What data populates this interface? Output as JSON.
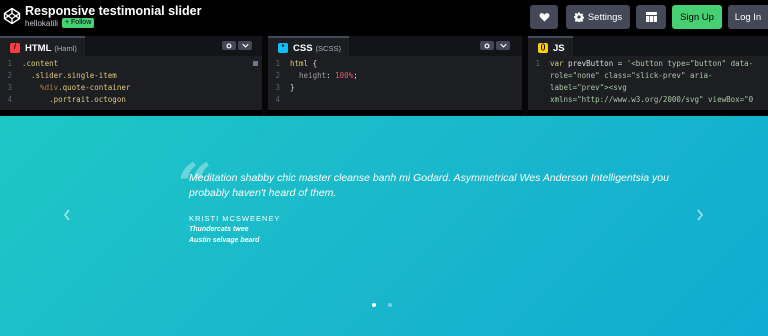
{
  "header": {
    "title": "Responsive testimonial slider",
    "author": "hellokatili",
    "follow_label": "+ Follow",
    "buttons": {
      "heart_icon": "heart-icon",
      "settings_label": "Settings",
      "layout_icon": "layout-icon",
      "signup_label": "Sign Up",
      "login_label": "Log In"
    }
  },
  "editors": [
    {
      "lang": "HTML",
      "sub": "(Haml)",
      "icon_letter": "/",
      "icon_color": "#ff3c41",
      "lines": [
        {
          "n": "1",
          "segments": [
            {
              "t": ".content",
              "c": "c-sel"
            }
          ]
        },
        {
          "n": "2",
          "segments": [
            {
              "t": "  .slider.single-item",
              "c": "c-sel"
            }
          ]
        },
        {
          "n": "3",
          "segments": [
            {
              "t": "    %div",
              "c": "c-tag"
            },
            {
              "t": ".quote-container",
              "c": "c-sel"
            }
          ]
        },
        {
          "n": "4",
          "segments": [
            {
              "t": "      .portrait.octogon",
              "c": "c-sel"
            }
          ]
        }
      ]
    },
    {
      "lang": "CSS",
      "sub": "(SCSS)",
      "icon_letter": "*",
      "icon_color": "#0ebeff",
      "lines": [
        {
          "n": "1",
          "segments": [
            {
              "t": "html",
              "c": "c-sel"
            },
            {
              "t": " {",
              "c": "c-plain"
            }
          ]
        },
        {
          "n": "2",
          "segments": [
            {
              "t": "  height",
              "c": "c-prop"
            },
            {
              "t": ": ",
              "c": "c-plain"
            },
            {
              "t": "100%",
              "c": "c-num"
            },
            {
              "t": ";",
              "c": "c-plain"
            }
          ]
        },
        {
          "n": "3",
          "segments": [
            {
              "t": "}",
              "c": "c-plain"
            }
          ]
        },
        {
          "n": "4",
          "segments": []
        }
      ]
    },
    {
      "lang": "JS",
      "sub": "",
      "icon_letter": "()",
      "icon_color": "#fcd000",
      "lines": [
        {
          "n": "1",
          "segments": [
            {
              "t": "var",
              "c": "c-kw"
            },
            {
              "t": " prevButton = ",
              "c": "c-plain"
            },
            {
              "t": "'<button type=\"button\" data-",
              "c": "c-str"
            }
          ]
        },
        {
          "n": "",
          "segments": [
            {
              "t": "role=\"none\" class=\"slick-prev\" aria-",
              "c": "c-str"
            }
          ]
        },
        {
          "n": "",
          "segments": [
            {
              "t": "label=\"prev\"><svg",
              "c": "c-str"
            }
          ]
        },
        {
          "n": "",
          "segments": [
            {
              "t": "xmlns=\"http://www.w3.org/2000/svg\" viewBox=\"0",
              "c": "c-str"
            }
          ]
        }
      ]
    }
  ],
  "preview": {
    "quote_mark": "“",
    "quote": "Meditation shabby chic master cleanse banh mi Godard. Asymmetrical Wes Anderson Intelligentsia you probably haven't heard of them.",
    "name": "KRISTI MCSWEENEY",
    "role_line1": "Thundercats twee",
    "role_line2": "Austin selvage beard",
    "dots": 2,
    "active_dot": 0
  },
  "colors": {
    "signup": "#47cf73",
    "button_bg": "#444857",
    "editor_bg": "#1d1e22",
    "preview_start": "#1dc7c5",
    "preview_end": "#10acd2"
  }
}
